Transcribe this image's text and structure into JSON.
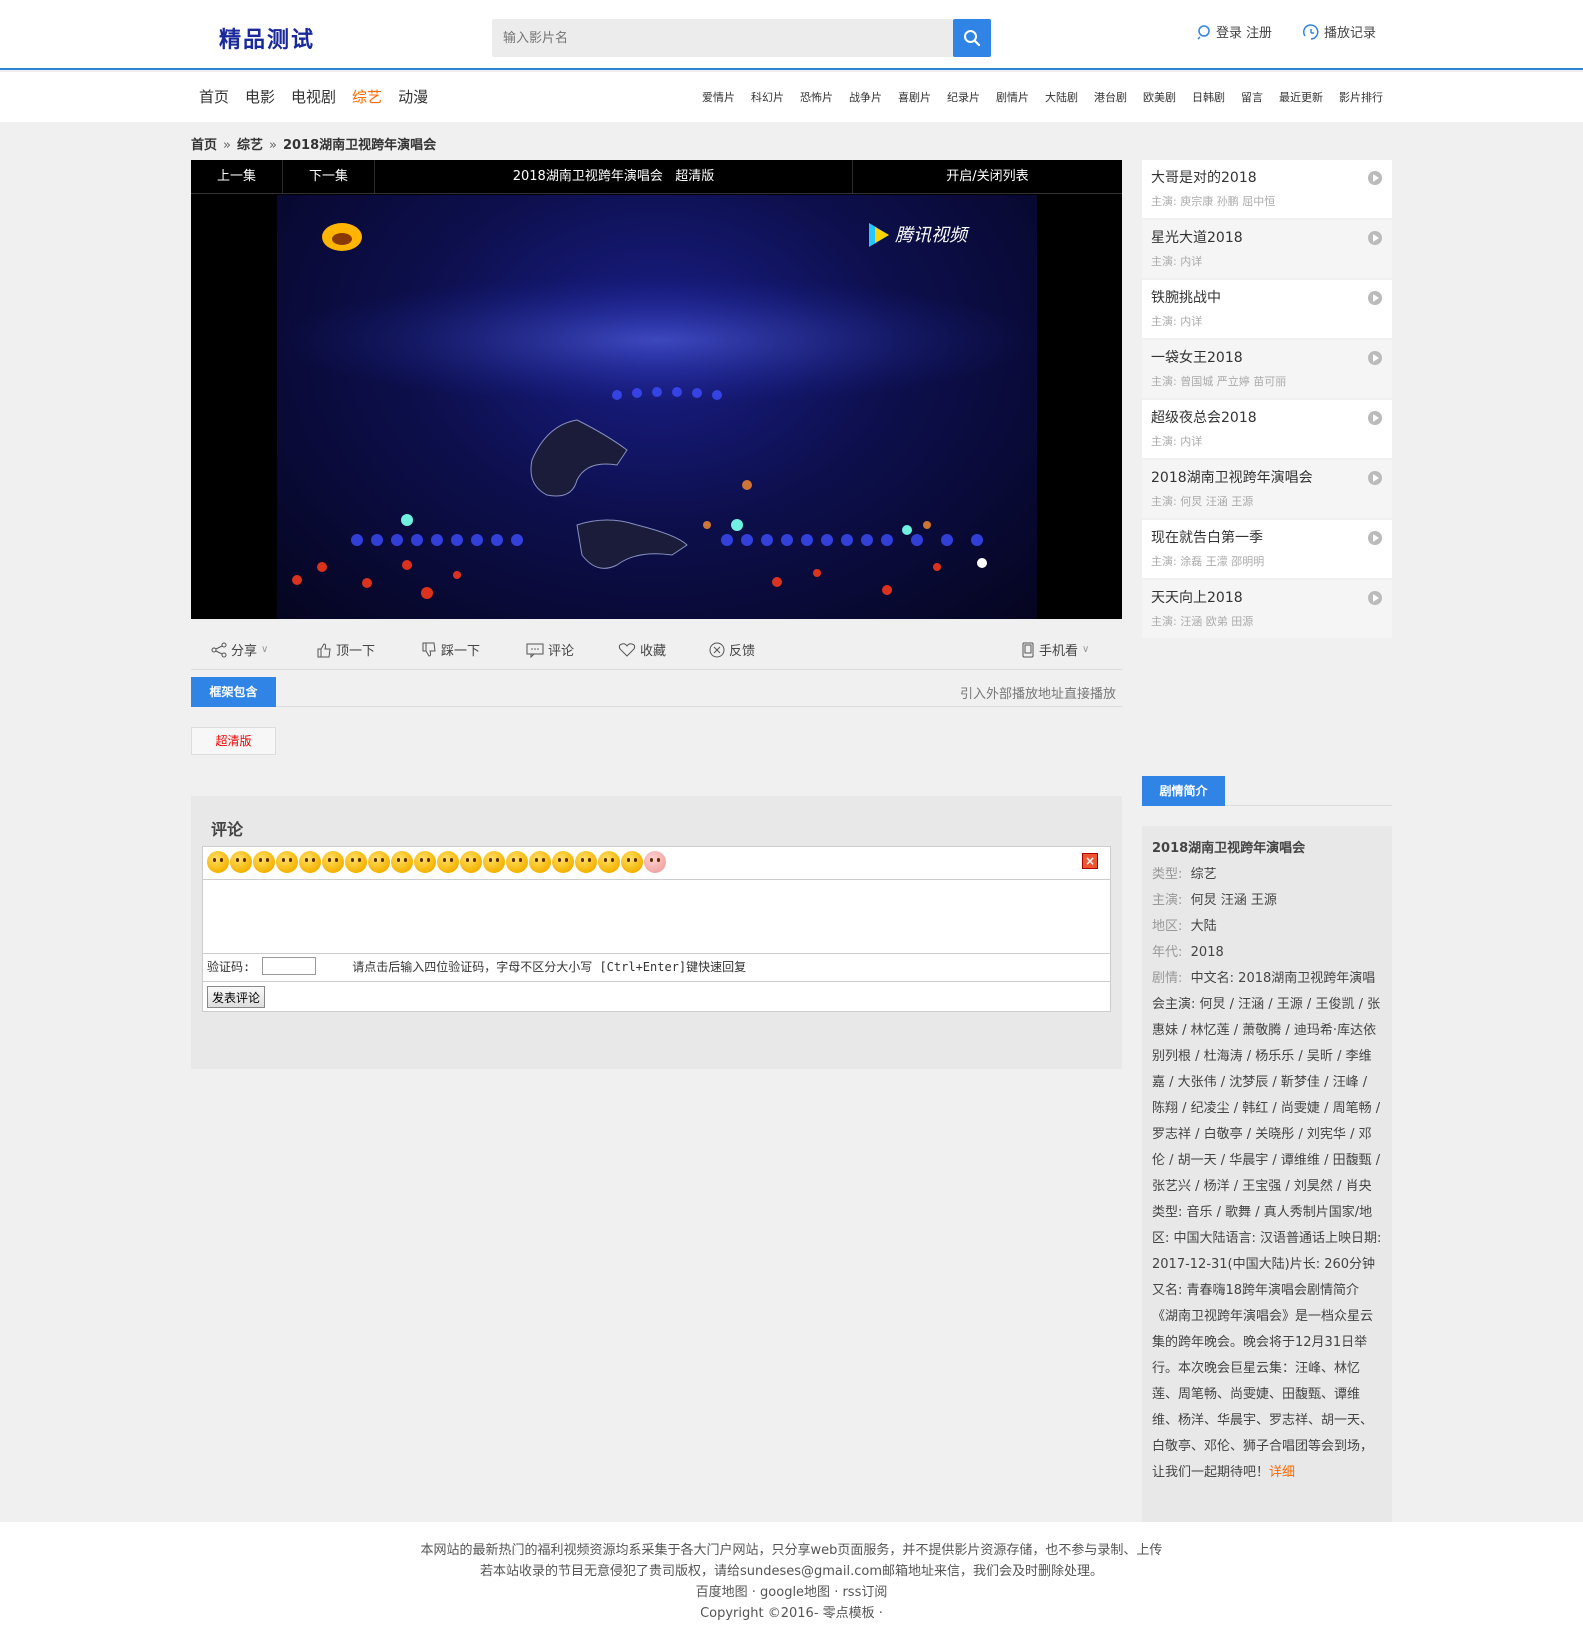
{
  "header": {
    "logo": "精品测试",
    "search_placeholder": "输入影片名",
    "login": "登录",
    "register": "注册",
    "history": "播放记录"
  },
  "nav": {
    "main": [
      "首页",
      "电影",
      "电视剧",
      "综艺",
      "动漫"
    ],
    "active": "综艺",
    "sub": [
      "爱情片",
      "科幻片",
      "恐怖片",
      "战争片",
      "喜剧片",
      "纪录片",
      "剧情片",
      "大陆剧",
      "港台剧",
      "欧美剧",
      "日韩剧",
      "留言",
      "最近更新",
      "影片排行"
    ]
  },
  "breadcrumb": {
    "home": "首页",
    "category": "综艺",
    "current": "2018湖南卫视跨年演唱会",
    "sep": "»"
  },
  "player": {
    "prev": "上一集",
    "next": "下一集",
    "title": "2018湖南卫视跨年演唱会",
    "quality": "超清版",
    "toggle_list": "开启/关闭列表",
    "watermark": "腾讯视频"
  },
  "actions": {
    "share": "分享",
    "like": "顶一下",
    "dislike": "踩一下",
    "comment": "评论",
    "favorite": "收藏",
    "feedback": "反馈",
    "mobile": "手机看"
  },
  "source": {
    "tab": "框架包含",
    "note": "引入外部播放地址直接播放",
    "quality_btn": "超清版"
  },
  "comments": {
    "title": "评论",
    "verify_label": "验证码:",
    "hint": "请点击后输入四位验证码，字母不区分大小写 [Ctrl+Enter]键快速回复",
    "submit": "发表评论",
    "close": "×"
  },
  "sidebar": {
    "cast_label": "主演:",
    "items": [
      {
        "title": "大哥是对的2018",
        "cast": "庾宗康 孙鹏 屈中恒"
      },
      {
        "title": "星光大道2018",
        "cast": "内详"
      },
      {
        "title": "铁腕挑战中",
        "cast": "内详"
      },
      {
        "title": "一袋女王2018",
        "cast": "曾国城 严立婷 苗可丽"
      },
      {
        "title": "超级夜总会2018",
        "cast": "内详"
      },
      {
        "title": "2018湖南卫视跨年演唱会",
        "cast": "何炅 汪涵 王源"
      },
      {
        "title": "现在就告白第一季",
        "cast": "涂磊 王濛 邵明明"
      },
      {
        "title": "天天向上2018",
        "cast": "汪涵 欧弟 田源"
      }
    ]
  },
  "intro": {
    "tab": "剧情简介",
    "title": "2018湖南卫视跨年演唱会",
    "type_label": "类型:",
    "type": "综艺",
    "cast_label": "主演:",
    "cast": "何炅  汪涵  王源",
    "region_label": "地区:",
    "region": "大陆",
    "year_label": "年代:",
    "year": "2018",
    "plot_label": "剧情:",
    "plot": "中文名: 2018湖南卫视跨年演唱会主演: 何炅 / 汪涵 / 王源 / 王俊凯 / 张惠妹 / 林忆莲 / 萧敬腾 / 迪玛希·库达依别列根 / 杜海涛 / 杨乐乐 / 吴昕 / 李维嘉 / 大张伟 / 沈梦辰 / 靳梦佳 / 汪峰 / 陈翔 / 纪凌尘 / 韩红 / 尚雯婕 / 周笔畅 / 罗志祥 / 白敬亭 / 关晓彤 / 刘宪华 / 邓伦 / 胡一天 / 华晨宇 / 谭维维 / 田馥甄 / 张艺兴 / 杨洋 / 王宝强 / 刘昊然 / 肖央类型: 音乐 / 歌舞 / 真人秀制片国家/地区: 中国大陆语言: 汉语普通话上映日期: 2017-12-31(中国大陆)片长: 260分钟又名: 青春嗨18跨年演唱会剧情简介 《湖南卫视跨年演唱会》是一档众星云集的跨年晚会。晚会将于12月31日举行。本次晚会巨星云集：汪峰、林忆莲、周笔畅、尚雯婕、田馥甄、谭维维、杨洋、华晨宇、罗志祥、胡一天、白敬亭、邓伦、狮子合唱团等会到场，让我们一起期待吧！",
    "more": "详细"
  },
  "footer": {
    "line1": "本网站的最新热门的福利视频资源均系采集于各大门户网站，只分享web页面服务，并不提供影片资源存储，也不参与录制、上传",
    "line2": "若本站收录的节目无意侵犯了贵司版权，请给sundeses@gmail.com邮箱地址来信，我们会及时删除处理。",
    "line3": "百度地图 · google地图 · rss订阅",
    "line4": "Copyright ©2016- 零点模板 ·"
  },
  "colors": {
    "accent": "#2f84e5",
    "active_nav": "#ff6a00",
    "quality": "#e00000"
  }
}
